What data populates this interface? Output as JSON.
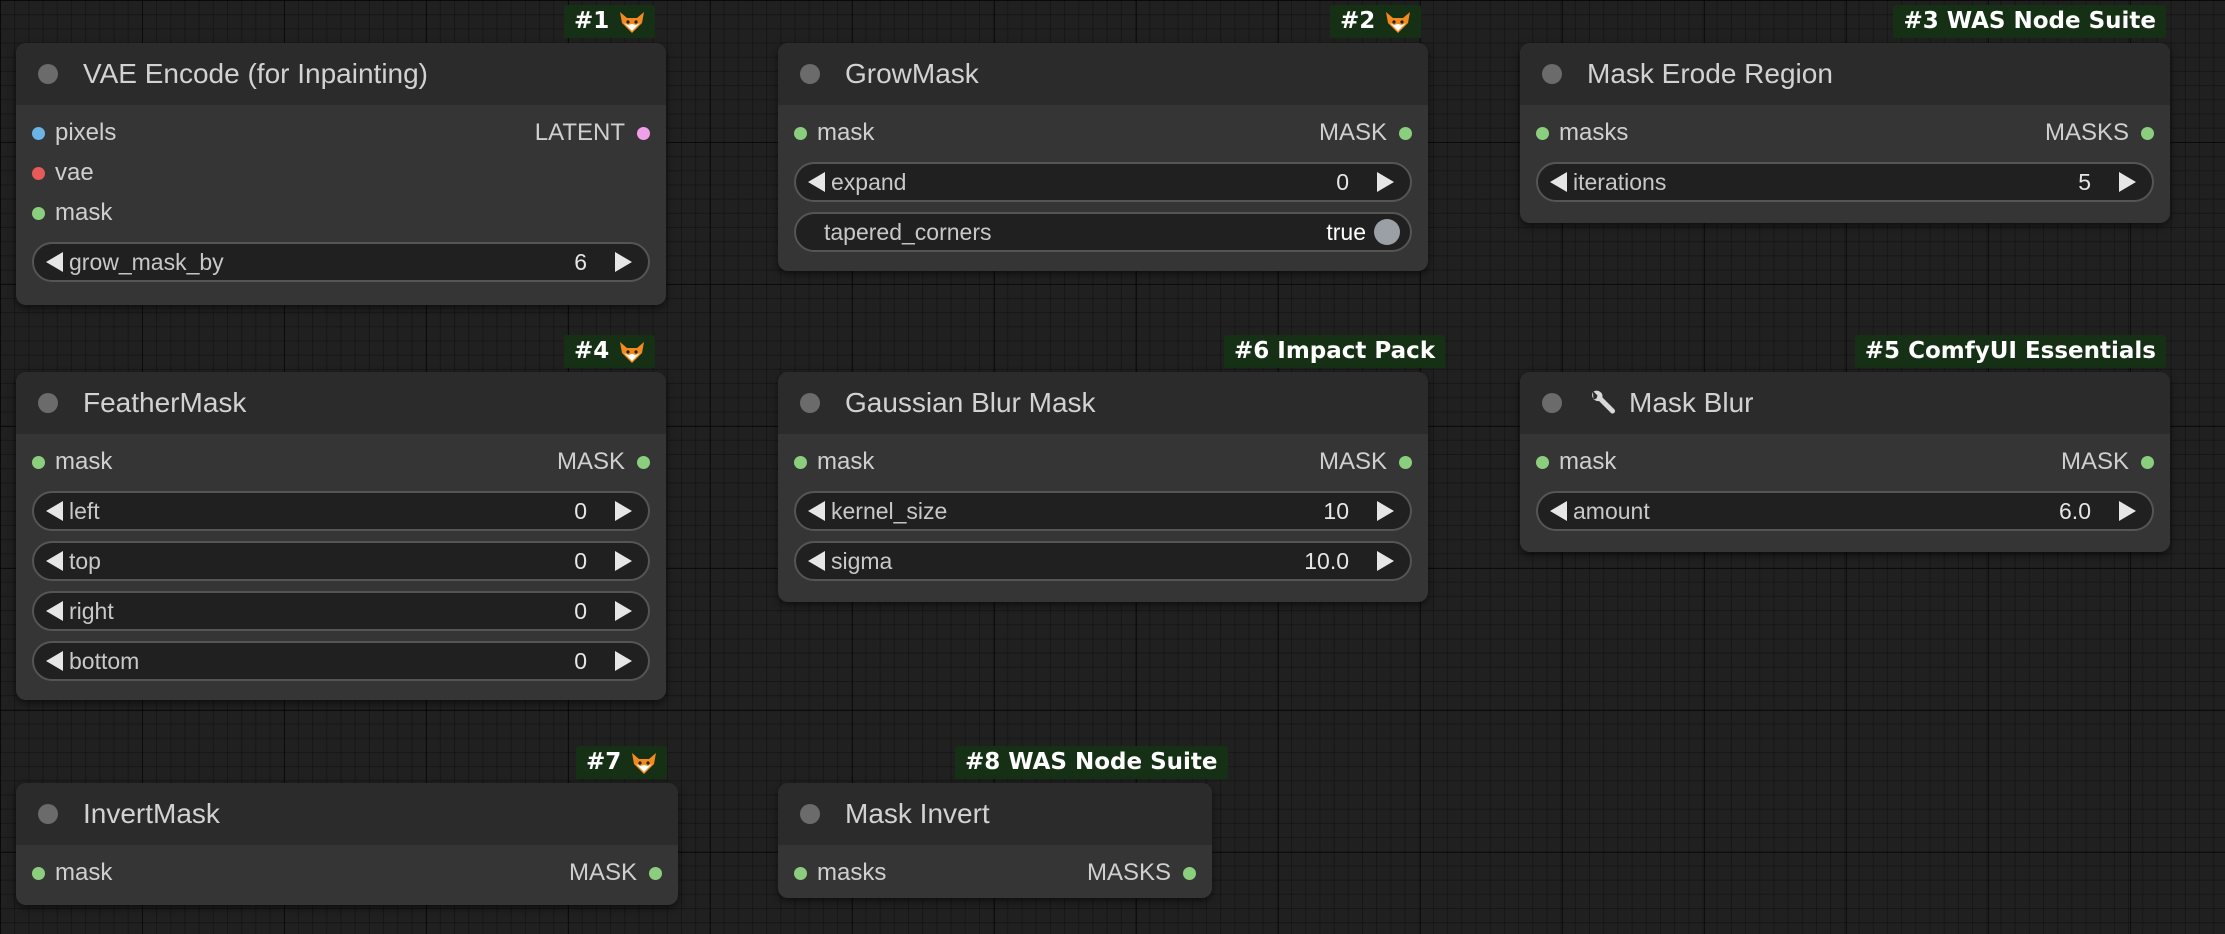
{
  "colors": {
    "pixels": "#6ab4e6",
    "vae": "#e85a5a",
    "mask": "#8bcf7e",
    "latent": "#f0a0e8",
    "badge_bg": "#163016"
  },
  "badges": {
    "b1": "#1",
    "b2": "#2",
    "b3": "#3 WAS Node Suite",
    "b4": "#4",
    "b6": "#6 Impact Pack",
    "b5": "#5 ComfyUI Essentials",
    "b7": "#7",
    "b8": "#8 WAS Node Suite"
  },
  "nodes": {
    "vae_encode": {
      "title": "VAE Encode (for Inpainting)",
      "in_pixels": "pixels",
      "in_vae": "vae",
      "in_mask": "mask",
      "out_latent": "LATENT",
      "grow_label": "grow_mask_by",
      "grow_value": "6"
    },
    "grow_mask": {
      "title": "GrowMask",
      "in_mask": "mask",
      "out_mask": "MASK",
      "expand_label": "expand",
      "expand_value": "0",
      "tapered_label": "tapered_corners",
      "tapered_value": "true"
    },
    "mask_erode": {
      "title": "Mask Erode Region",
      "in_masks": "masks",
      "out_masks": "MASKS",
      "iter_label": "iterations",
      "iter_value": "5"
    },
    "feather_mask": {
      "title": "FeatherMask",
      "in_mask": "mask",
      "out_mask": "MASK",
      "left_label": "left",
      "left_value": "0",
      "top_label": "top",
      "top_value": "0",
      "right_label": "right",
      "right_value": "0",
      "bottom_label": "bottom",
      "bottom_value": "0"
    },
    "gaussian_blur": {
      "title": "Gaussian Blur Mask",
      "in_mask": "mask",
      "out_mask": "MASK",
      "kernel_label": "kernel_size",
      "kernel_value": "10",
      "sigma_label": "sigma",
      "sigma_value": "10.0"
    },
    "mask_blur": {
      "title": "Mask Blur",
      "in_mask": "mask",
      "out_mask": "MASK",
      "amount_label": "amount",
      "amount_value": "6.0"
    },
    "invert_mask": {
      "title": "InvertMask",
      "in_mask": "mask",
      "out_mask": "MASK"
    },
    "mask_invert": {
      "title": "Mask Invert",
      "in_masks": "masks",
      "out_masks": "MASKS"
    }
  }
}
